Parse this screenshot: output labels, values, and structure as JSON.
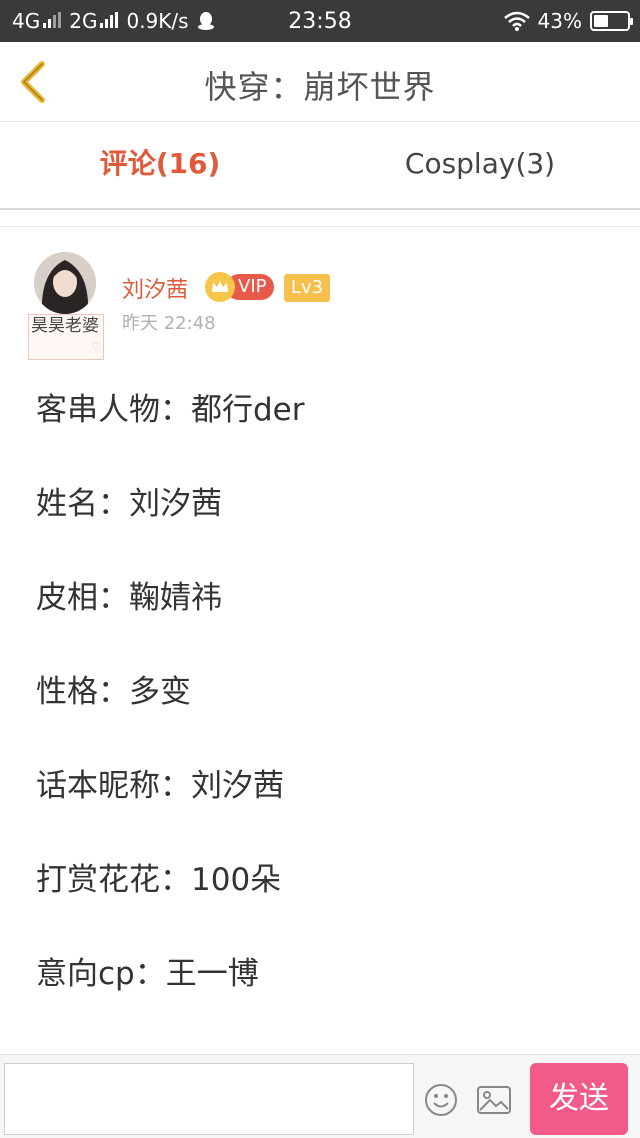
{
  "status_bar": {
    "net1": "4G",
    "net2": "2G",
    "speed": "0.9K/s",
    "time": "23:58",
    "battery": "43%",
    "battery_level": 0.43
  },
  "header": {
    "title": "快穿：崩坏世界",
    "back_icon": "chevron-left-icon"
  },
  "tabs": [
    {
      "label": "评论(16)",
      "active": true
    },
    {
      "label": "Cosplay(3)",
      "active": false
    }
  ],
  "comment": {
    "username": "刘汐茜",
    "vip_badge": "VIP",
    "level_badge": "Lv3",
    "time": "昨天 22:48",
    "avatar_tag": "昊昊老婆",
    "lines": [
      "客串人物：都行der",
      "姓名：刘汐茜",
      "皮相：鞠婧祎",
      "性格：多变",
      "话本昵称：刘汐茜",
      "打赏花花：100朵",
      "意向cp：王一博"
    ]
  },
  "input_bar": {
    "placeholder": "",
    "send_label": "发送"
  },
  "colors": {
    "accent": "#e05a3a",
    "send": "#f25a8a",
    "status_bar": "#3a3a3a",
    "vip": "#e75a4a",
    "level": "#f6c04e"
  }
}
